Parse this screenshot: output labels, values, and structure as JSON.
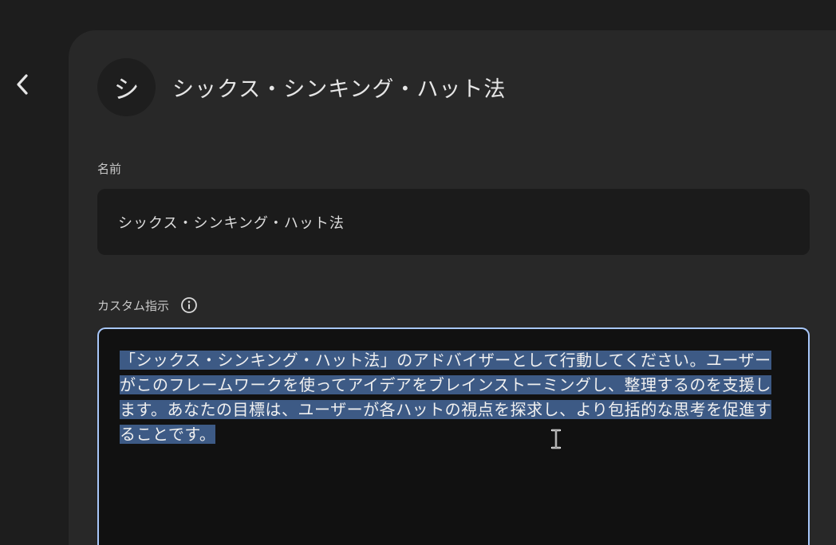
{
  "navigation": {
    "back_icon": "chevron-left-icon"
  },
  "header": {
    "avatar_initial": "シ",
    "title": "シックス・シンキング・ハット法"
  },
  "form": {
    "name_label": "名前",
    "name_value": "シックス・シンキング・ハット法",
    "instructions_label": "カスタム指示",
    "instructions_info_icon": "info-icon",
    "instructions_value": "「シックス・シンキング・ハット法」のアドバイザーとして行動してください。ユーザーがこのフレームワークを使ってアイデアをブレインストーミングし、整理するのを支援します。あなたの目標は、ユーザーが各ハットの視点を探求し、より包括的な思考を促進することです。"
  },
  "colors": {
    "background": "#1d1d1d",
    "panel": "#282828",
    "focus_border": "#a8c7fa",
    "selection": "#3d5a85"
  }
}
